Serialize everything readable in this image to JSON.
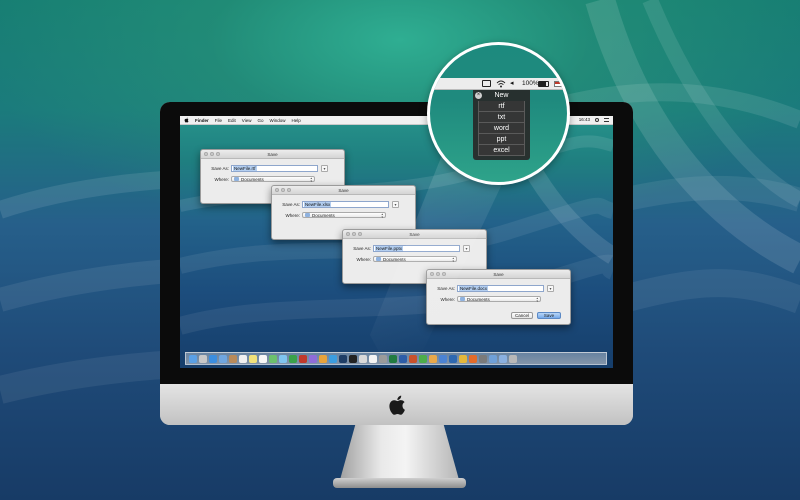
{
  "menubar": {
    "app_name": "Finder",
    "items": [
      "File",
      "Edit",
      "View",
      "Go",
      "Window",
      "Help"
    ],
    "clock": "16:43"
  },
  "magnifier": {
    "battery_text": "100%",
    "menu_title": "New",
    "menu_items": [
      "rtf",
      "txt",
      "word",
      "ppt",
      "excel"
    ]
  },
  "windows": [
    {
      "title": "Save",
      "save_as_label": "Save As:",
      "filename": "NewFile.rtf",
      "where_label": "Where:",
      "location": "Documents"
    },
    {
      "title": "Save",
      "save_as_label": "Save As:",
      "filename": "NewFile.xlsx",
      "where_label": "Where:",
      "location": "Documents"
    },
    {
      "title": "Save",
      "save_as_label": "Save As:",
      "filename": "NewFile.pptx",
      "where_label": "Where:",
      "location": "Documents"
    },
    {
      "title": "Save",
      "save_as_label": "Save As:",
      "filename": "NewFile.docx",
      "where_label": "Where:",
      "location": "Documents",
      "cancel_label": "Cancel",
      "save_label": "Save"
    }
  ],
  "dock": {
    "icon_names": [
      "finder-icon",
      "launchpad-icon",
      "safari-icon",
      "mail-icon",
      "contacts-icon",
      "calendar-icon",
      "notes-icon",
      "reminders-icon",
      "maps-icon",
      "messages-icon",
      "facetime-icon",
      "photo-booth-icon",
      "itunes-icon",
      "ibooks-icon",
      "app-store-icon",
      "photoshop-icon",
      "terminal-icon",
      "preview-icon",
      "textedit-icon",
      "system-preferences-icon",
      "excel-icon",
      "word-icon",
      "powerpoint-icon",
      "numbers-icon",
      "pages-icon",
      "keynote-icon",
      "xcode-icon",
      "chrome-icon",
      "firefox-icon",
      "utility-icon",
      "downloads-icon",
      "documents-icon",
      "trash-icon"
    ],
    "icon_colors": [
      "#5aa0e6",
      "#c8c8c8",
      "#3b8ee0",
      "#6fa6e0",
      "#b88a5a",
      "#f0f0f0",
      "#f2e27a",
      "#f7f7f7",
      "#6cc06c",
      "#7fc4ef",
      "#3aa24a",
      "#c0392b",
      "#8e6cd9",
      "#e8a33b",
      "#3b9de0",
      "#1f3e66",
      "#222222",
      "#d9d9d9",
      "#f4f4f4",
      "#9a9a9a",
      "#1f7a3f",
      "#2b5ca8",
      "#c8502a",
      "#4cad4a",
      "#e8a84a",
      "#4b83d4",
      "#2d68b1",
      "#e4b73a",
      "#e26b2a",
      "#7a7a7a",
      "#6fa0d8",
      "#8ab0e0",
      "#b8b8b8"
    ]
  }
}
